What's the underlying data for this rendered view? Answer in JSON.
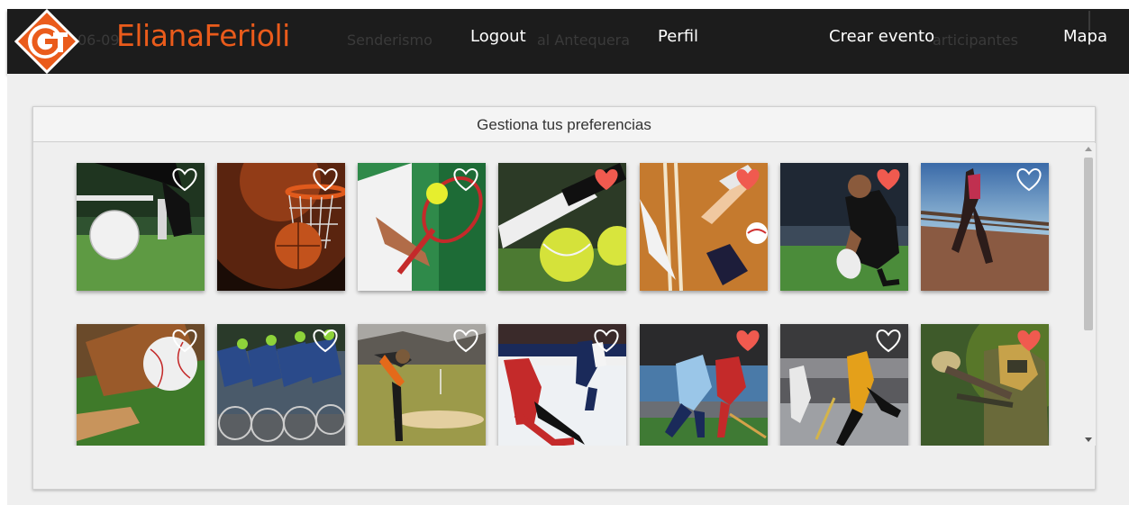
{
  "navbar": {
    "brand": "ElianaFerioli",
    "links": [
      "Logout",
      "Perfil",
      "Crear evento",
      "Mapa"
    ],
    "background_text": [
      "06-09",
      "Senderismo",
      "al Antequera",
      "articipantes"
    ],
    "colors": {
      "background": "#1c1c1c",
      "brand": "#ea5b1b"
    }
  },
  "panel": {
    "title": "Gestiona tus preferencias"
  },
  "tiles": [
    {
      "icon": "soccer-image",
      "favorite": false
    },
    {
      "icon": "basketball-image",
      "favorite": false
    },
    {
      "icon": "tennis-player-image",
      "favorite": false
    },
    {
      "icon": "tennis-balls-image",
      "favorite": true
    },
    {
      "icon": "volleyball-image",
      "favorite": true
    },
    {
      "icon": "rugby-image",
      "favorite": true
    },
    {
      "icon": "running-image",
      "favorite": false
    },
    {
      "icon": "baseball-image",
      "favorite": false
    },
    {
      "icon": "cycling-image",
      "favorite": false
    },
    {
      "icon": "golf-image",
      "favorite": false
    },
    {
      "icon": "ice-hockey-image",
      "favorite": false
    },
    {
      "icon": "field-hockey-image",
      "favorite": true
    },
    {
      "icon": "roller-hockey-image",
      "favorite": false
    },
    {
      "icon": "paintball-image",
      "favorite": true
    }
  ],
  "heart_colors": {
    "active": "#f05a4f",
    "inactive": "#ffffff"
  }
}
